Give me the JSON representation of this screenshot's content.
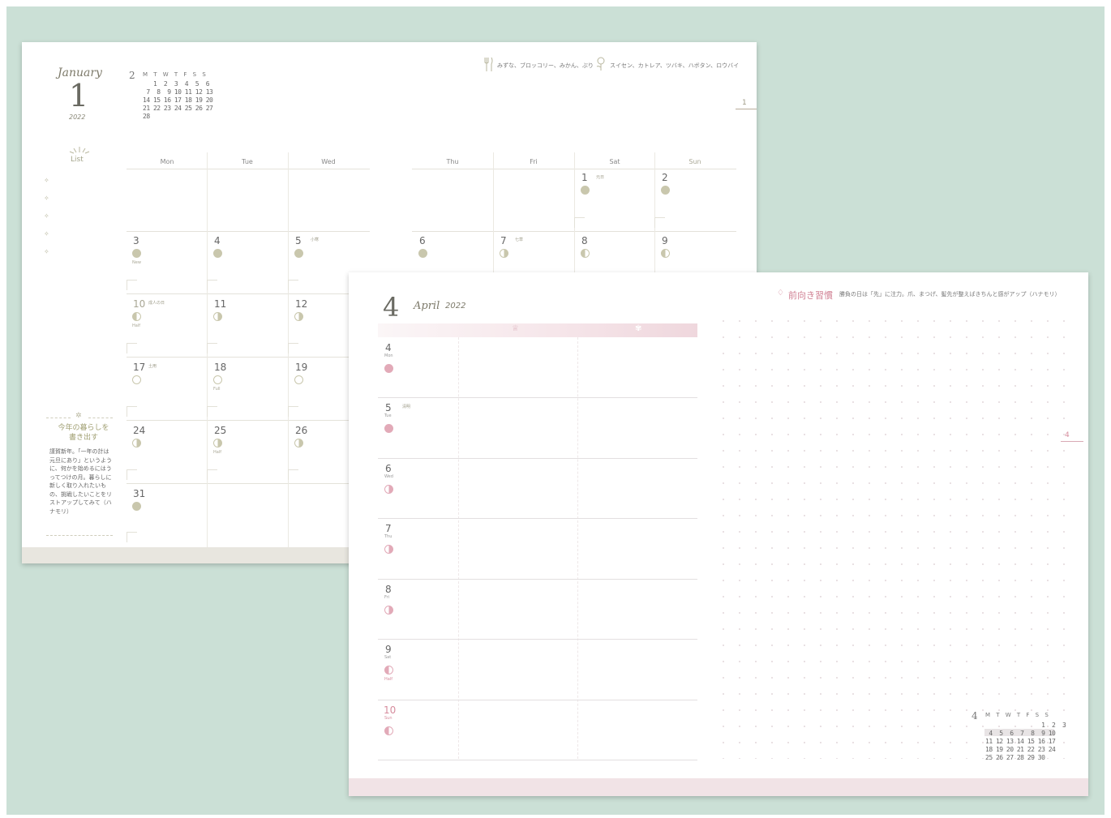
{
  "january_page": {
    "month_word": "January",
    "month_num": "1",
    "year": "2022",
    "mini_cal": {
      "month_num": "2",
      "header": "M T W T F S S",
      "rows": [
        "   1  2  3  4  5  6",
        " 7  8  9 10 11 12 13",
        "14 15 16 17 18 19 20",
        "21 22 23 24 25 26 27",
        "28"
      ]
    },
    "season_food": "みずな、ブロッコリー、みかん、ぶり",
    "season_flower": "スイセン、カトレア、ツバキ、ハボタン、ロウバイ",
    "tab_number": "1",
    "list_label": "List",
    "list_stars": [
      "✧",
      "✧",
      "✧",
      "✧",
      "✧"
    ],
    "weekdays": [
      "Mon",
      "Tue",
      "Wed",
      "Thu",
      "Fri",
      "Sat",
      "Sun"
    ],
    "days": [
      {
        "n": "1",
        "hol": "元日"
      },
      {
        "n": "2",
        "hol": ""
      },
      {
        "n": "3",
        "moon_label": "New",
        "hol": ""
      },
      {
        "n": "4",
        "hol": ""
      },
      {
        "n": "5",
        "hol": "小寒"
      },
      {
        "n": "6",
        "hol": ""
      },
      {
        "n": "7",
        "hol": "七草"
      },
      {
        "n": "8",
        "hol": ""
      },
      {
        "n": "9",
        "hol": ""
      },
      {
        "n": "10",
        "hol": "成人の日",
        "moon_label": "Half"
      },
      {
        "n": "11",
        "hol": ""
      },
      {
        "n": "12",
        "hol": ""
      },
      {
        "n": "17",
        "hol": "土用"
      },
      {
        "n": "18",
        "hol": "",
        "moon_label": "Full"
      },
      {
        "n": "19",
        "hol": ""
      },
      {
        "n": "24",
        "hol": ""
      },
      {
        "n": "25",
        "hol": "",
        "moon_label": "Half"
      },
      {
        "n": "26",
        "hol": ""
      },
      {
        "n": "31",
        "hol": ""
      }
    ],
    "note_ornament": "✲",
    "note_title": "今年の暮らしを\n書き出す",
    "note_body": "謹賀新年。「一年の計は元旦にあり」というように、何かを始めるにはうってつけの月。暮らしに新しく取り入れたいもの、挑戦したいことをリストアップしてみて（ハナモリ）"
  },
  "april_page": {
    "month_num": "4",
    "month_word": "April",
    "year": "2022",
    "band_icon_left": "♕",
    "band_icon_right": "✾",
    "habit_icon": "♢",
    "habit_title": "前向き習慣",
    "habit_body": "勝負の日は「先」に注力。爪、まつげ、髪先が整えばきちんと感がアップ（ハナモリ）",
    "tab_number": "4",
    "days": [
      {
        "n": "4",
        "d": "Mon",
        "hol": ""
      },
      {
        "n": "5",
        "d": "Tue",
        "hol": "清明"
      },
      {
        "n": "6",
        "d": "Wed",
        "hol": ""
      },
      {
        "n": "7",
        "d": "Thu",
        "hol": ""
      },
      {
        "n": "8",
        "d": "Fri",
        "hol": ""
      },
      {
        "n": "9",
        "d": "Sat",
        "hol": "",
        "moon_label": "Half"
      },
      {
        "n": "10",
        "d": "Sun",
        "hol": ""
      }
    ],
    "mini_cal": {
      "month_num": "4",
      "header": "M T W T F S S",
      "rows": [
        "                1  2  3",
        " 4  5  6  7  8  9 10",
        "11 12 13 14 15 16 17",
        "18 19 20 21 22 23 24",
        "25 26 27 28 29 30"
      ]
    }
  },
  "colors": {
    "background": "#cbe0d6",
    "accent_green": "#c9c7ad",
    "accent_pink": "#e2aab8"
  }
}
